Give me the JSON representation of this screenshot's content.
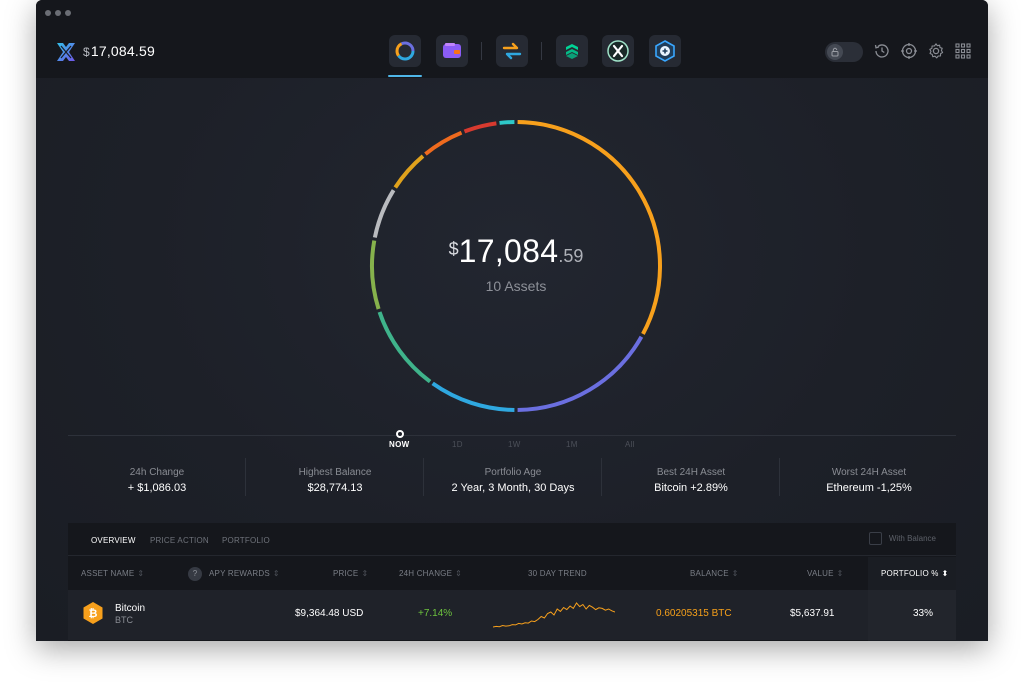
{
  "window": {
    "total_balance": {
      "currency": "$",
      "amount": "17,084.59"
    }
  },
  "topbar": {
    "apps": [
      {
        "name": "portfolio",
        "active": true
      },
      {
        "name": "wallet",
        "active": false
      },
      {
        "name": "exchange",
        "active": false
      },
      {
        "name": "compound-app",
        "active": false
      },
      {
        "name": "xdc-app",
        "active": false
      },
      {
        "name": "app-store",
        "active": false
      }
    ],
    "right_icons": [
      "lock-icon",
      "history-icon",
      "backup-icon",
      "settings-icon",
      "grid-icon"
    ]
  },
  "portfolio": {
    "currency": "$",
    "amount_int": "17,084",
    "amount_dec": ".59",
    "assets_label": "10 Assets",
    "segments": [
      {
        "color": "#f7a01c",
        "share": 0.33
      },
      {
        "color": "#6b6fe0",
        "share": 0.17
      },
      {
        "color": "#2fa8e0",
        "share": 0.1
      },
      {
        "color": "#3fb38b",
        "share": 0.1
      },
      {
        "color": "#86b24c",
        "share": 0.08
      },
      {
        "color": "#b9bbbf",
        "share": 0.06
      },
      {
        "color": "#e0a21c",
        "share": 0.05
      },
      {
        "color": "#ee6a1e",
        "share": 0.05
      },
      {
        "color": "#d73a2f",
        "share": 0.04
      },
      {
        "color": "#2ec8c8",
        "share": 0.02
      }
    ]
  },
  "timeline": {
    "items": [
      "NOW",
      "1D",
      "1W",
      "1M",
      "All"
    ],
    "active": "NOW"
  },
  "stats": [
    {
      "label": "24h Change",
      "value": "+ $1,086.03"
    },
    {
      "label": "Highest Balance",
      "value": "$28,774.13"
    },
    {
      "label": "Portfolio Age",
      "value": "2 Year, 3 Month, 30 Days"
    },
    {
      "label": "Best 24H Asset",
      "value": "Bitcoin +2.89%"
    },
    {
      "label": "Worst 24H Asset",
      "value": "Ethereum -1,25%"
    }
  ],
  "table": {
    "tabs": [
      "OVERVIEW",
      "PRICE ACTION",
      "PORTFOLIO"
    ],
    "with_balance_label": "With Balance",
    "headers": {
      "asset_name": "ASSET NAME",
      "apy": "APY REWARDS",
      "price": "PRICE",
      "change": "24H CHANGE",
      "trend": "30 DAY TREND",
      "balance": "BALANCE",
      "value": "VALUE",
      "portfolio": "PORTFOLIO %"
    },
    "rows": [
      {
        "name": "Bitcoin",
        "ticker": "BTC",
        "price": "$9,364.48 USD",
        "change": "+7.14%",
        "balance": "0.60205315 BTC",
        "value": "$5,637.91",
        "portfolio": "33%",
        "trend": [
          0.1,
          0.12,
          0.11,
          0.15,
          0.13,
          0.14,
          0.18,
          0.17,
          0.22,
          0.2,
          0.24,
          0.23,
          0.3,
          0.28,
          0.35,
          0.45,
          0.4,
          0.55,
          0.6,
          0.5,
          0.7,
          0.62,
          0.75,
          0.68,
          0.8,
          0.72,
          0.9,
          0.78,
          0.85,
          0.7,
          0.82,
          0.76,
          0.68,
          0.74,
          0.72,
          0.66,
          0.7,
          0.64,
          0.6
        ]
      }
    ]
  }
}
